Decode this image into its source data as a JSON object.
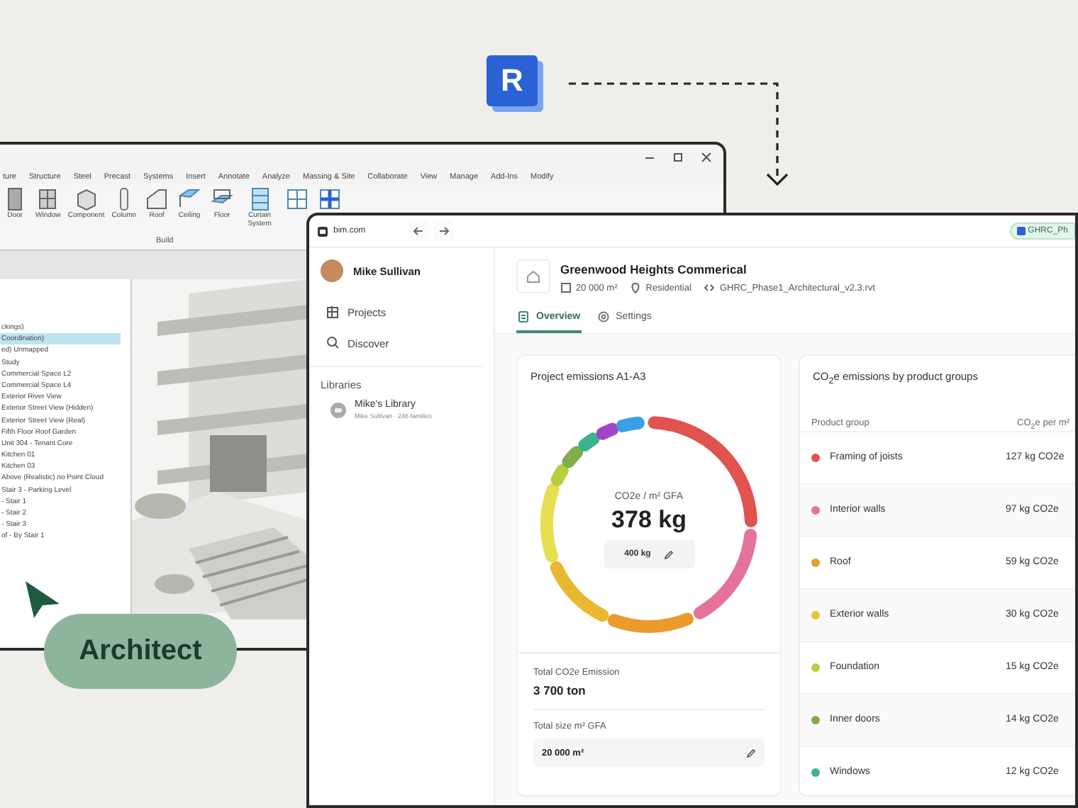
{
  "logo": {
    "letter": "R"
  },
  "revit_window": {
    "ribbon_tabs": [
      "ture",
      "Structure",
      "Steel",
      "Precast",
      "Systems",
      "Insert",
      "Annotate",
      "Analyze",
      "Massing & Site",
      "Collaborate",
      "View",
      "Manage",
      "Add-Ins",
      "Modify"
    ],
    "ribbon_tools": [
      {
        "label": "Door",
        "kind": "door"
      },
      {
        "label": "Window",
        "kind": "window"
      },
      {
        "label": "Component",
        "kind": "component"
      },
      {
        "label": "Column",
        "kind": "column"
      },
      {
        "label": "Roof",
        "kind": "roof"
      },
      {
        "label": "Ceiling",
        "kind": "ceiling"
      },
      {
        "label": "Floor",
        "kind": "floor"
      },
      {
        "label": "Curtain System",
        "kind": "curtain"
      },
      {
        "kind": "grid"
      },
      {
        "kind": "mullion"
      }
    ],
    "ribbon_group": "Build",
    "browser_items": [
      {
        "label": "ckings)",
        "selected": false
      },
      {
        "label": "Coordination)",
        "selected": true
      },
      {
        "label": "ed) Unmapped",
        "selected": false
      },
      {
        "label": "Study",
        "selected": false
      },
      {
        "label": "Commercial Space L2",
        "selected": false
      },
      {
        "label": "Commercial Space L4",
        "selected": false
      },
      {
        "label": "Exterior River View",
        "selected": false
      },
      {
        "label": "Exterior Street View (Hidden)",
        "selected": false
      },
      {
        "label": "Exterior Street View (Real)",
        "selected": false
      },
      {
        "label": "Fifth Floor Roof Garden",
        "selected": false
      },
      {
        "label": "Unit 304 - Tenant Core",
        "selected": false
      },
      {
        "label": "Kitchen 01",
        "selected": false
      },
      {
        "label": "Kitchen 03",
        "selected": false
      },
      {
        "label": "Above (Realistic) no Point Cloud",
        "selected": false
      },
      {
        "label": "Stair 3 - Parking Level",
        "selected": false
      },
      {
        "label": "- Stair 1",
        "selected": false
      },
      {
        "label": "- Stair 2",
        "selected": false
      },
      {
        "label": "- Stair 3",
        "selected": false
      },
      {
        "label": "of - By Stair 1",
        "selected": false
      }
    ]
  },
  "tag": {
    "label": "Architect"
  },
  "browser_window": {
    "url": "bim.com",
    "file_badge": "GHRC_Ph",
    "user": "Mike Sullivan",
    "nav": [
      {
        "label": "Projects",
        "kind": "projects"
      },
      {
        "label": "Discover",
        "kind": "discover"
      }
    ],
    "libraries_heading": "Libraries",
    "libraries": [
      {
        "name": "Mike's Library",
        "meta": "Mike Sullivan · 246 families"
      }
    ],
    "project": {
      "title": "Greenwood Heights Commerical",
      "area": "20 000 m²",
      "type": "Residential",
      "file": "GHRC_Phase1_Architectural_v2.3.rvt"
    },
    "tabs": [
      {
        "label": "Overview",
        "kind": "overview",
        "selected": true
      },
      {
        "label": "Settings",
        "kind": "settings",
        "selected": false
      }
    ],
    "emissions_card": {
      "title": "Project emissions A1-A3",
      "metric_label": "CO2e / m² GFA",
      "value": "378 kg",
      "target": "400 kg",
      "total_label": "Total CO2e Emission",
      "total_value": "3 700 ton",
      "size_label": "Total size m² GFA",
      "size_value": "20 000 m²"
    },
    "groups_card": {
      "title": "CO$_{2}$e emissions by product groups",
      "columns": [
        "Product group",
        "CO$_{2}$e per m²"
      ],
      "rows": [
        {
          "name": "Framing of joists",
          "value": "127 kg CO2e",
          "color": "#e0534f"
        },
        {
          "name": "Interior walls",
          "value": "97 kg CO2e",
          "color": "#e4739a"
        },
        {
          "name": "Roof",
          "value": "59 kg CO2e",
          "color": "#eb9a2c"
        },
        {
          "name": "Exterior walls",
          "value": "30 kg CO2e",
          "color": "#e6c530"
        },
        {
          "name": "Foundation",
          "value": "15 kg CO2e",
          "color": "#b6cf3e"
        },
        {
          "name": "Inner doors",
          "value": "14 kg CO2e",
          "color": "#7fae4a"
        },
        {
          "name": "Windows",
          "value": "12 kg CO2e",
          "color": "#3bb38f"
        }
      ]
    }
  }
}
